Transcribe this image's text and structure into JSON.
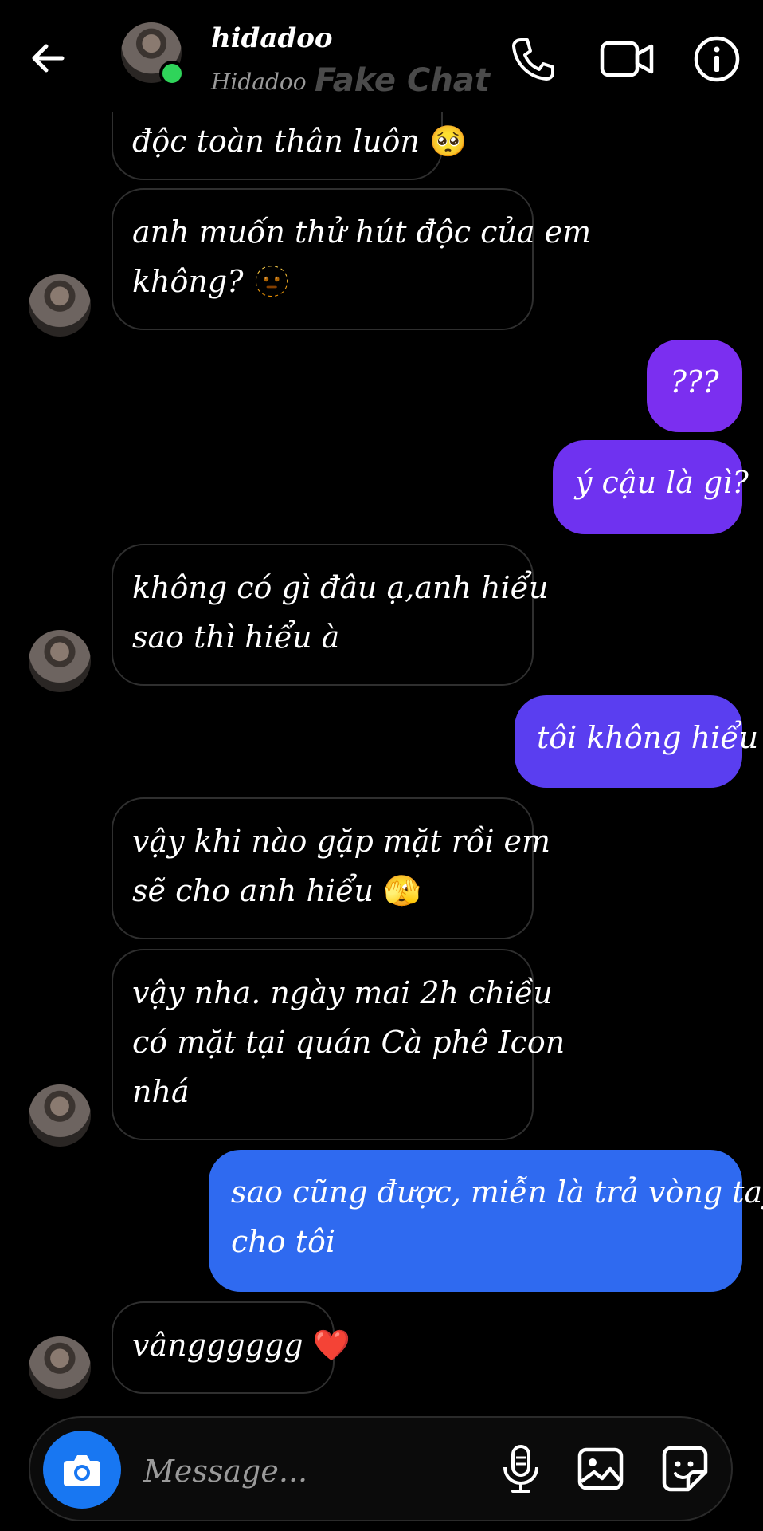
{
  "header": {
    "contact_name": "hidadoo",
    "contact_username": "Hidadoo",
    "watermark": "Fake Chat"
  },
  "messages": [
    {
      "from": "them",
      "text": "độc toàn thân luôn",
      "emoji": "🥺"
    },
    {
      "from": "them",
      "line1": "anh muốn thử hút độc của em",
      "line2": "không?",
      "emoji": "🫥"
    },
    {
      "from": "me",
      "text": "???"
    },
    {
      "from": "me",
      "text": "ý cậu là gì?"
    },
    {
      "from": "them",
      "line1": "không có gì đâu ạ,anh hiểu",
      "line2": "sao thì hiểu à"
    },
    {
      "from": "me",
      "text": "tôi không hiểu"
    },
    {
      "from": "them",
      "line1": "vậy khi nào gặp mặt rồi em",
      "line2": "sẽ cho anh hiểu",
      "emoji": "🫣"
    },
    {
      "from": "them",
      "line1": "vậy nha. ngày mai 2h chiều",
      "line2": "có mặt tại quán Cà phê Icon",
      "line3": "nhá"
    },
    {
      "from": "me",
      "line1": "sao cũng được, miễn là trả vòng tay",
      "line2": "cho tôi"
    },
    {
      "from": "them",
      "text": "vângggggg",
      "emoji": "❤️"
    }
  ],
  "composer": {
    "placeholder": "Message..."
  },
  "icons": {
    "back": "back-arrow-icon",
    "call": "phone-icon",
    "video": "video-camera-icon",
    "info": "info-icon",
    "camera": "camera-icon",
    "mic": "microphone-icon",
    "gallery": "image-icon",
    "sticker": "sticker-icon"
  },
  "colors": {
    "background": "#000000",
    "bubble_outgoing_top": "#8a2be2",
    "bubble_outgoing_mid": "#5b3ff0",
    "bubble_outgoing_bottom": "#2f6df0",
    "camera_button": "#1877f2",
    "online": "#2fd45a"
  }
}
